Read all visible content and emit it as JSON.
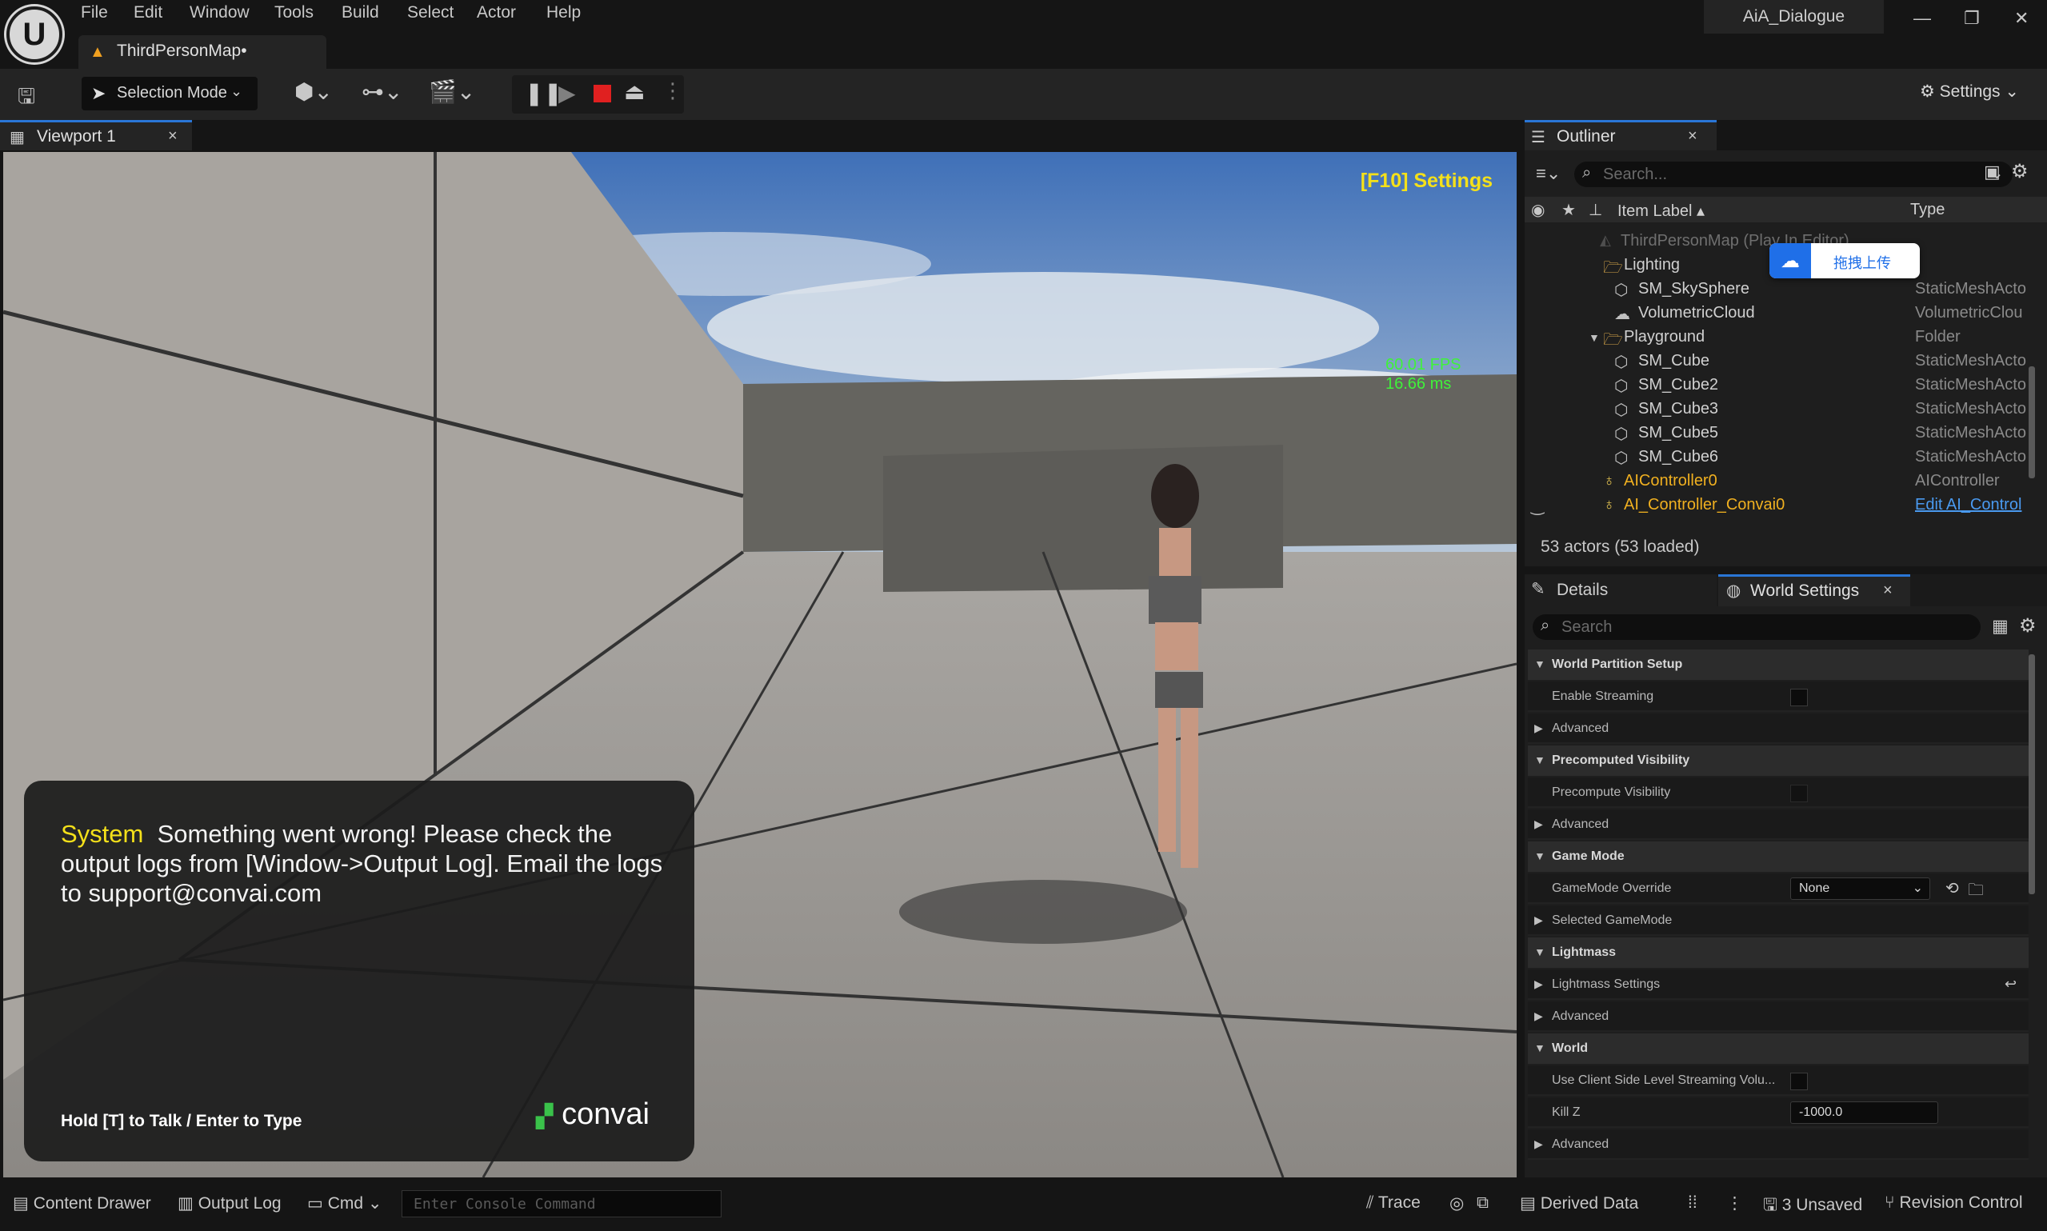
{
  "menu": [
    "File",
    "Edit",
    "Window",
    "Tools",
    "Build",
    "Select",
    "Actor",
    "Help"
  ],
  "map_tab": {
    "label": "ThirdPersonMap•"
  },
  "project_name": "AiA_Dialogue",
  "toolbar": {
    "selection_mode": "Selection Mode",
    "settings": "Settings"
  },
  "viewport": {
    "tab_label": "Viewport 1",
    "settings_hint": "[F10] Settings",
    "fps": "60.01 FPS",
    "frame_ms": "16.66 ms",
    "dialog": {
      "speaker": "System",
      "message": "Something went wrong! Please check the output logs from [Window->Output Log]. Email the logs to support@convai.com",
      "hint": "Hold [T] to Talk / Enter to Type",
      "brand": "convai"
    }
  },
  "outliner": {
    "tab_label": "Outliner",
    "search_placeholder": "Search...",
    "col_label": "Item Label ▴",
    "col_type": "Type",
    "rows": [
      {
        "name": "ThirdPersonMap (Play In Editor)",
        "type": ""
      },
      {
        "name": "Lighting",
        "type": ""
      },
      {
        "name": "SM_SkySphere",
        "type": "StaticMeshActo"
      },
      {
        "name": "VolumetricCloud",
        "type": "VolumetricClou"
      },
      {
        "name": "Playground",
        "type": "Folder"
      },
      {
        "name": "SM_Cube",
        "type": "StaticMeshActo"
      },
      {
        "name": "SM_Cube2",
        "type": "StaticMeshActo"
      },
      {
        "name": "SM_Cube3",
        "type": "StaticMeshActo"
      },
      {
        "name": "SM_Cube5",
        "type": "StaticMeshActo"
      },
      {
        "name": "SM_Cube6",
        "type": "StaticMeshActo"
      },
      {
        "name": "AIController0",
        "type": "AIController"
      },
      {
        "name": "AI_Controller_Convai0",
        "type": "Edit AI_Control"
      }
    ],
    "actor_count": "53 actors (53 loaded)",
    "upload_label": "拖拽上传"
  },
  "details": {
    "tab_details": "Details",
    "tab_world": "World Settings",
    "search_placeholder": "Search",
    "rows": [
      {
        "kind": "cat",
        "label": "World Partition Setup"
      },
      {
        "kind": "prop",
        "label": "Enable Streaming",
        "control": "checkbox"
      },
      {
        "kind": "prop",
        "label": "Advanced",
        "control": "expand"
      },
      {
        "kind": "cat",
        "label": "Precomputed Visibility"
      },
      {
        "kind": "prop",
        "label": "Precompute Visibility",
        "control": "checkbox"
      },
      {
        "kind": "prop",
        "label": "Advanced",
        "control": "expand"
      },
      {
        "kind": "cat",
        "label": "Game Mode"
      },
      {
        "kind": "prop",
        "label": "GameMode Override",
        "control": "select",
        "value": "None"
      },
      {
        "kind": "prop",
        "label": "Selected GameMode",
        "control": "expand"
      },
      {
        "kind": "cat",
        "label": "Lightmass"
      },
      {
        "kind": "prop",
        "label": "Lightmass Settings",
        "control": "expand"
      },
      {
        "kind": "prop",
        "label": "Advanced",
        "control": "expand"
      },
      {
        "kind": "cat",
        "label": "World"
      },
      {
        "kind": "prop",
        "label": "Use Client Side Level Streaming Volu...",
        "control": "checkbox"
      },
      {
        "kind": "prop",
        "label": "Kill Z",
        "control": "number",
        "value": "-1000.0"
      },
      {
        "kind": "prop",
        "label": "Advanced",
        "control": "expand"
      }
    ]
  },
  "statusbar": {
    "content_drawer": "Content Drawer",
    "output_log": "Output Log",
    "cmd": "Cmd",
    "console_placeholder": "Enter Console Command",
    "trace": "Trace",
    "derived_data": "Derived Data",
    "unsaved": "3 Unsaved",
    "revision_control": "Revision Control"
  },
  "colors": {
    "accent": "#2a76d6",
    "hint_yellow": "#f4e01a",
    "fps_green": "#3ff23a",
    "stop_red": "#e02020"
  }
}
